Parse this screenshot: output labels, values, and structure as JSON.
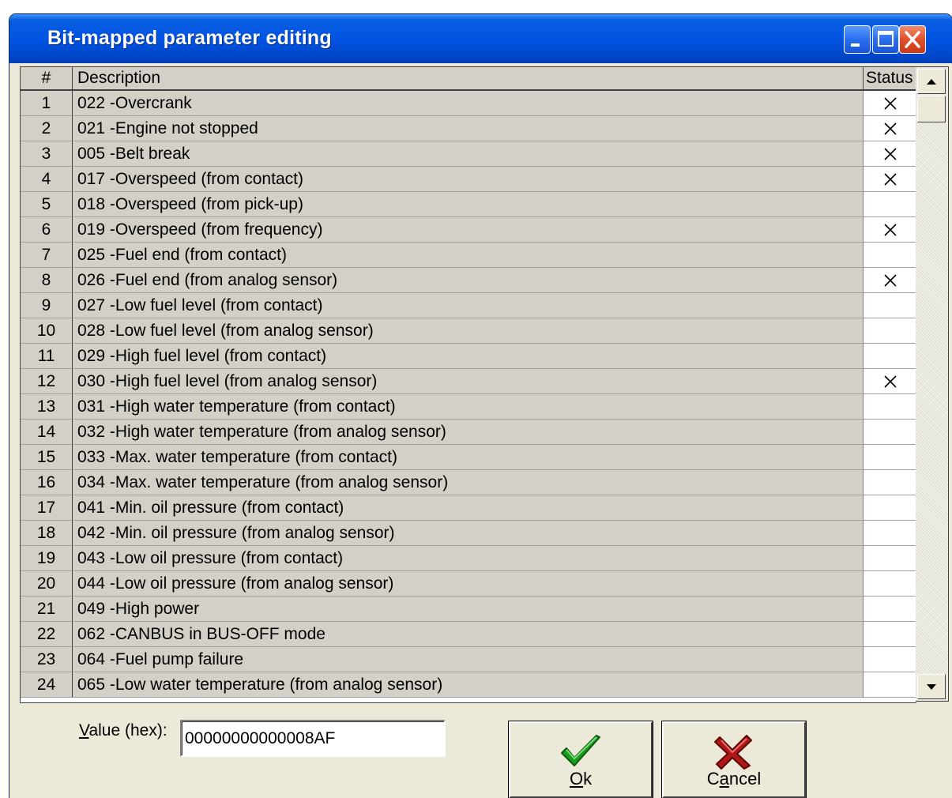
{
  "window": {
    "title": "Bit-mapped parameter editing"
  },
  "colors": {
    "title_bar": "#0054e3",
    "grid_cells": "#d4d0c8",
    "check_mark": "#1a9a1a",
    "cancel_mark": "#b01818"
  },
  "table": {
    "headers": {
      "num": "#",
      "description": "Description",
      "status": "Status"
    },
    "rows": [
      {
        "num": "1",
        "description": "022 -Overcrank",
        "status": "X"
      },
      {
        "num": "2",
        "description": "021 -Engine not stopped",
        "status": "X"
      },
      {
        "num": "3",
        "description": "005 -Belt break",
        "status": "X"
      },
      {
        "num": "4",
        "description": "017 -Overspeed (from contact)",
        "status": "X"
      },
      {
        "num": "5",
        "description": "018 -Overspeed (from pick-up)",
        "status": ""
      },
      {
        "num": "6",
        "description": "019 -Overspeed (from frequency)",
        "status": "X"
      },
      {
        "num": "7",
        "description": "025 -Fuel end (from contact)",
        "status": ""
      },
      {
        "num": "8",
        "description": "026 -Fuel end (from analog sensor)",
        "status": "X"
      },
      {
        "num": "9",
        "description": "027 -Low fuel level (from contact)",
        "status": ""
      },
      {
        "num": "10",
        "description": "028 -Low fuel level (from analog sensor)",
        "status": ""
      },
      {
        "num": "11",
        "description": "029 -High fuel level (from contact)",
        "status": ""
      },
      {
        "num": "12",
        "description": "030 -High fuel level (from analog sensor)",
        "status": "X"
      },
      {
        "num": "13",
        "description": "031 -High water temperature (from contact)",
        "status": ""
      },
      {
        "num": "14",
        "description": "032 -High water temperature (from analog sensor)",
        "status": ""
      },
      {
        "num": "15",
        "description": "033 -Max. water temperature (from contact)",
        "status": ""
      },
      {
        "num": "16",
        "description": "034 -Max. water temperature (from analog sensor)",
        "status": ""
      },
      {
        "num": "17",
        "description": "041 -Min. oil pressure (from contact)",
        "status": ""
      },
      {
        "num": "18",
        "description": "042 -Min. oil pressure (from analog sensor)",
        "status": ""
      },
      {
        "num": "19",
        "description": "043 -Low oil pressure (from contact)",
        "status": ""
      },
      {
        "num": "20",
        "description": "044 -Low oil pressure (from analog sensor)",
        "status": ""
      },
      {
        "num": "21",
        "description": "049 -High power",
        "status": ""
      },
      {
        "num": "22",
        "description": "062 -CANBUS in BUS-OFF mode",
        "status": ""
      },
      {
        "num": "23",
        "description": "064 -Fuel pump failure",
        "status": ""
      },
      {
        "num": "24",
        "description": "065 -Low water temperature (from analog sensor)",
        "status": ""
      }
    ]
  },
  "footer": {
    "value_label_underlined": "V",
    "value_label_rest": "alue (hex):",
    "value_hex": "00000000000008AF",
    "ok_underlined": "O",
    "ok_rest": "k",
    "cancel_prefix": "C",
    "cancel_underlined": "a",
    "cancel_rest": "ncel"
  }
}
